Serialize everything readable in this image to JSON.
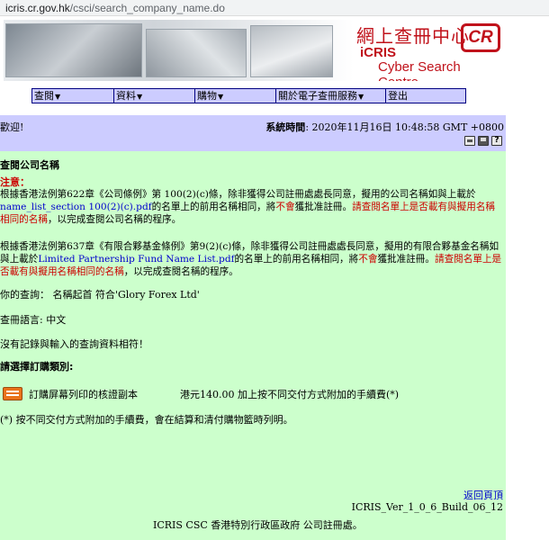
{
  "browser": {
    "url_domain": "icris.cr.gov.hk",
    "url_path": "/csci/search_company_name.do"
  },
  "banner": {
    "title_cn": "網上查冊中心",
    "icris": "iCRIS",
    "csc": "Cyber Search Centre",
    "logo": "CR"
  },
  "menu": [
    {
      "label": "查閱"
    },
    {
      "label": "資料"
    },
    {
      "label": "購物"
    },
    {
      "label": "關於電子查冊服務"
    },
    {
      "label": "登出"
    }
  ],
  "header": {
    "welcome": "歡迎!",
    "systime_label": "系統時間",
    "systime_value": ": 2020年11月16日 10:48:58 GMT +0800"
  },
  "icons": {
    "print": "print-icon",
    "save": "save-icon",
    "help": "help-icon",
    "basket": "shopping-basket-icon"
  },
  "colors": {
    "menu_bg": "#ccccff",
    "content_bg": "#ccffcc",
    "notice_red": "#cc0000",
    "link_blue": "#0000cc"
  },
  "content": {
    "page_title": "查閱公司名稱",
    "notice_title": "注意：",
    "p1_a": "根據香港法例第622章《公司條例》第 100(2)(c)條，除非獲得公司註冊處處長同意，擬用的公司名稱如與上載於",
    "p1_link": "name_list_section 100(2)(c).pdf",
    "p1_b": "的名單上的前用名稱相同，將",
    "p1_red1": "不會",
    "p1_c": "獲批准註冊。",
    "p1_red2": "請查閱名單上是否載有與擬用名稱相同的名稱",
    "p1_d": "，以完成查閱公司名稱的程序。",
    "p2_a": "根據香港法例第637章《有限合夥基金條例》第9(2)(c)條，除非獲得公司註冊處處長同意，擬用的有限合夥基金名稱如與上載於",
    "p2_link": "Limited Partnership Fund Name List.pdf",
    "p2_b": "的名單上的前用名稱相同，將",
    "p2_red1": "不會",
    "p2_c": "獲批准註冊。",
    "p2_red2": "請查閱名單上是否載有與擬用名稱相同的名稱",
    "p2_d": "，以完成查閱名稱的程序。",
    "query": "你的查詢： 名稱起首 符合'Glory Forex Ltd'",
    "language": "查冊語言: 中文",
    "no_record": "沒有記錄與輸入的查詢資料相符！",
    "choose_type": "請選擇訂購類別:",
    "order_label": "訂購屏幕列印的核證副本",
    "order_price": "港元140.00 加上按不同交付方式附加的手續費(*)",
    "footnote": "(*) 按不同交付方式附加的手續費，會在結算和清付購物籃時列明。",
    "back_link": "返回頁頂",
    "build": "ICRIS_Ver_1_0_6_Build_06_12",
    "copyright": "ICRIS CSC 香港特別行政區政府 公司註冊處。"
  }
}
